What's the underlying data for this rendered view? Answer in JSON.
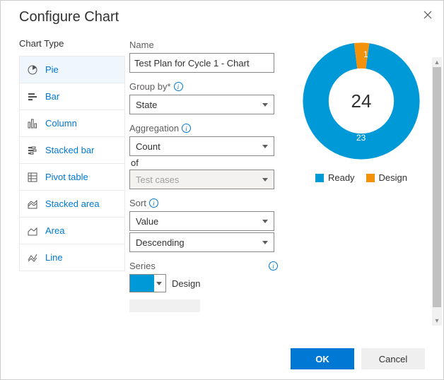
{
  "dialog": {
    "title": "Configure Chart"
  },
  "chart_type": {
    "label": "Chart Type",
    "items": [
      {
        "id": "pie",
        "label": "Pie",
        "selected": true
      },
      {
        "id": "bar",
        "label": "Bar"
      },
      {
        "id": "column",
        "label": "Column"
      },
      {
        "id": "stacked-bar",
        "label": "Stacked bar"
      },
      {
        "id": "pivot-table",
        "label": "Pivot table"
      },
      {
        "id": "stacked-area",
        "label": "Stacked area"
      },
      {
        "id": "area",
        "label": "Area"
      },
      {
        "id": "line",
        "label": "Line"
      }
    ]
  },
  "form": {
    "name_label": "Name",
    "name_value": "Test Plan for Cycle 1 - Chart",
    "group_by_label": "Group by*",
    "group_by_value": "State",
    "aggregation_label": "Aggregation",
    "aggregation_value": "Count",
    "of_label": "of",
    "of_value": "Test cases",
    "sort_label": "Sort",
    "sort_field_value": "Value",
    "sort_dir_value": "Descending",
    "series_label": "Series",
    "series_color": "#0099d8",
    "series_name": "Design"
  },
  "chart_data": {
    "type": "pie",
    "title": "",
    "total": 24,
    "series": [
      {
        "name": "Ready",
        "value": 23,
        "color": "#0099d8"
      },
      {
        "name": "Design",
        "value": 1,
        "color": "#f2910a"
      }
    ],
    "legend_position": "bottom"
  },
  "buttons": {
    "ok": "OK",
    "cancel": "Cancel"
  }
}
